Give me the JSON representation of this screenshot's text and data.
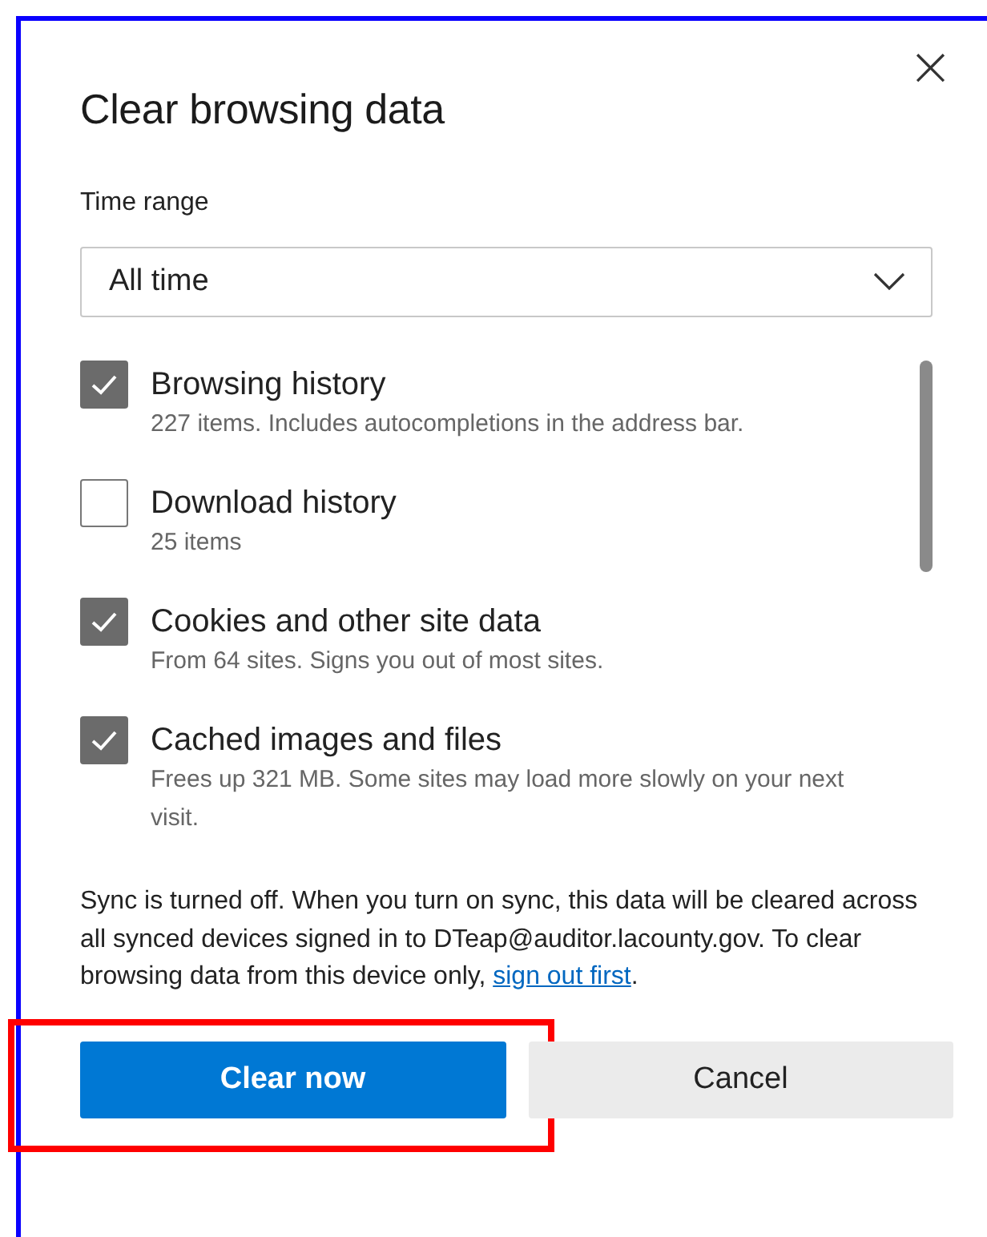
{
  "dialog": {
    "title": "Clear browsing data",
    "close": "×"
  },
  "time_range": {
    "label": "Time range",
    "value": "All time"
  },
  "options": [
    {
      "title": "Browsing history",
      "detail": "227 items. Includes autocompletions in the address bar.",
      "checked": true
    },
    {
      "title": "Download history",
      "detail": "25 items",
      "checked": false
    },
    {
      "title": "Cookies and other site data",
      "detail": "From 64 sites. Signs you out of most sites.",
      "checked": true
    },
    {
      "title": "Cached images and files",
      "detail": "Frees up 321 MB. Some sites may load more slowly on your next visit.",
      "checked": true
    }
  ],
  "sync_note": {
    "text": "Sync is turned off. When you turn on sync, this data will be cleared across all synced devices signed in to DTeap@auditor.lacounty.gov. To clear browsing data from this device only, ",
    "link": "sign out first",
    "end": "."
  },
  "buttons": [
    {
      "label": "Clear now",
      "kind": "primary",
      "highlighted": true
    },
    {
      "label": "Cancel",
      "kind": "secondary",
      "highlighted": false
    }
  ]
}
